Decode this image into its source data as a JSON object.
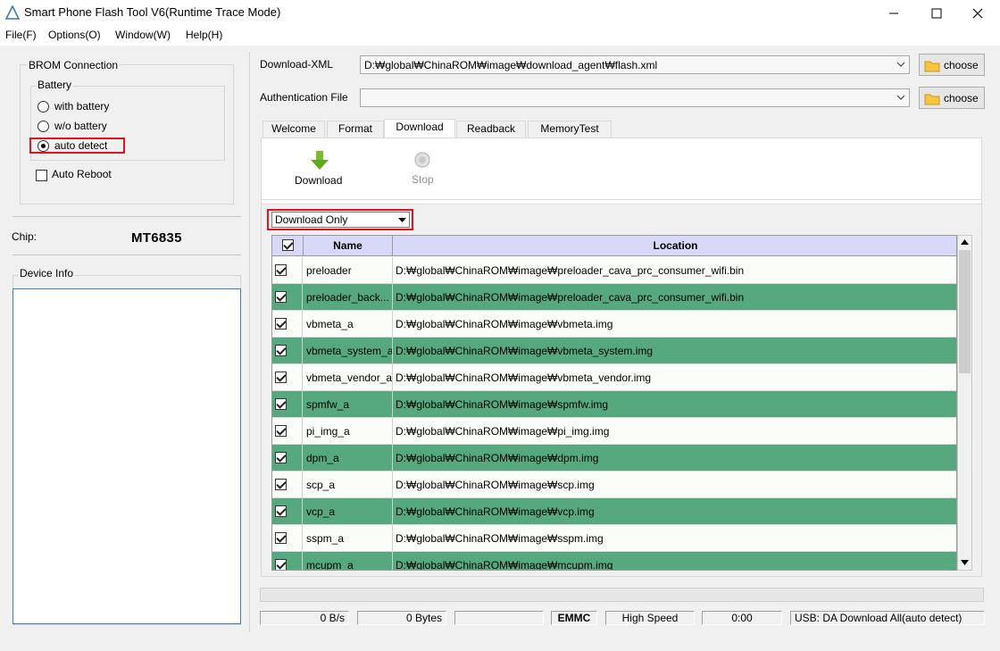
{
  "window": {
    "title": "Smart Phone Flash Tool V6(Runtime Trace Mode)"
  },
  "menu": [
    "File(F)",
    "Options(O)",
    "Window(W)",
    "Help(H)"
  ],
  "left": {
    "brom_title": "BROM Connection",
    "battery_title": "Battery",
    "battery_options": [
      "with battery",
      "w/o battery",
      "auto detect"
    ],
    "battery_selected": "auto detect",
    "auto_reboot": "Auto Reboot",
    "chip_label": "Chip:",
    "chip_value": "MT6835",
    "device_info_title": "Device Info"
  },
  "download_xml": {
    "label": "Download-XML",
    "value": "D:₩global₩ChinaROM₩image₩download_agent₩flash.xml",
    "button": "choose"
  },
  "auth_file": {
    "label": "Authentication File",
    "value": "",
    "button": "choose"
  },
  "tabs": [
    "Welcome",
    "Format",
    "Download",
    "Readback",
    "MemoryTest"
  ],
  "active_tab": "Download",
  "toolbar": {
    "download": "Download",
    "stop": "Stop"
  },
  "mode_select": "Download Only",
  "table": {
    "columns": [
      "Name",
      "Location"
    ],
    "rows": [
      {
        "checked": true,
        "name": "preloader",
        "location": "D:₩global₩ChinaROM₩image₩preloader_cava_prc_consumer_wifi.bin"
      },
      {
        "checked": true,
        "name": "preloader_back...",
        "location": "D:₩global₩ChinaROM₩image₩preloader_cava_prc_consumer_wifi.bin"
      },
      {
        "checked": true,
        "name": "vbmeta_a",
        "location": "D:₩global₩ChinaROM₩image₩vbmeta.img"
      },
      {
        "checked": true,
        "name": "vbmeta_system_a",
        "location": "D:₩global₩ChinaROM₩image₩vbmeta_system.img"
      },
      {
        "checked": true,
        "name": "vbmeta_vendor_a",
        "location": "D:₩global₩ChinaROM₩image₩vbmeta_vendor.img"
      },
      {
        "checked": true,
        "name": "spmfw_a",
        "location": "D:₩global₩ChinaROM₩image₩spmfw.img"
      },
      {
        "checked": true,
        "name": "pi_img_a",
        "location": "D:₩global₩ChinaROM₩image₩pi_img.img"
      },
      {
        "checked": true,
        "name": "dpm_a",
        "location": "D:₩global₩ChinaROM₩image₩dpm.img"
      },
      {
        "checked": true,
        "name": "scp_a",
        "location": "D:₩global₩ChinaROM₩image₩scp.img"
      },
      {
        "checked": true,
        "name": "vcp_a",
        "location": "D:₩global₩ChinaROM₩image₩vcp.img"
      },
      {
        "checked": true,
        "name": "sspm_a",
        "location": "D:₩global₩ChinaROM₩image₩sspm.img"
      },
      {
        "checked": true,
        "name": "mcupm_a",
        "location": "D:₩global₩ChinaROM₩image₩mcupm.img"
      }
    ]
  },
  "status": {
    "speed": "0 B/s",
    "bytes": "0 Bytes",
    "blank": "",
    "storage": "EMMC",
    "mode": "High Speed",
    "time": "0:00",
    "usb": "USB: DA Download All(auto detect)"
  },
  "colors": {
    "row_even": "#56a97e",
    "row_odd": "#fbfdf8",
    "header": "#d8d8f8",
    "highlight_box": "#e0141e"
  }
}
